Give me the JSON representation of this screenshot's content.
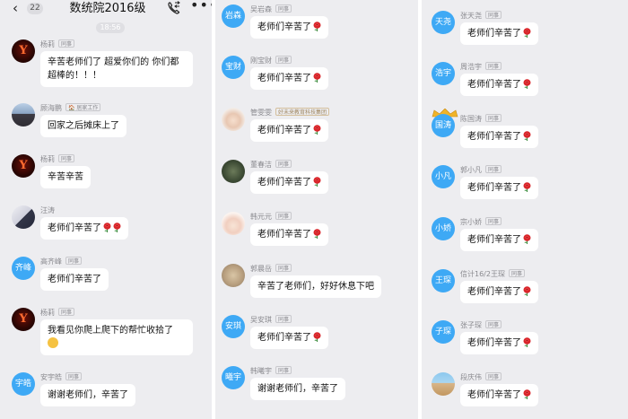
{
  "header": {
    "back_icon": "chevron-left-icon",
    "badge": "22",
    "title": "数统院2016级",
    "call_icon": "phone-call-icon",
    "more_icon": "more-icon",
    "time": "18:56"
  },
  "tags": {
    "classmate": "同事",
    "home": "居家工作",
    "vip": "好未来教育科技集团"
  },
  "col1": [
    {
      "avatar_text": "",
      "sender": "杨莉",
      "text": "辛苦老师们了 超爱你们的 你们都",
      "text2": "超棒的！！！"
    },
    {
      "avatar_text": "",
      "sender": "顾海鹏",
      "text": "回家之后摊床上了"
    },
    {
      "avatar_text": "",
      "sender": "杨莉",
      "text": "辛苦辛苦"
    },
    {
      "avatar_text": "",
      "sender": "汪涛",
      "text": "老师们辛苦了"
    },
    {
      "avatar_text": "齐峰",
      "sender": "高齐峰",
      "text": "老师们辛苦了"
    },
    {
      "avatar_text": "",
      "sender": "杨莉",
      "text": "我看见你爬上爬下的帮忙收拾了"
    },
    {
      "avatar_text": "宇皓",
      "sender": "安宇皓",
      "text": "谢谢老师们，辛苦了"
    }
  ],
  "col2": [
    {
      "avatar_text": "岩森",
      "sender": "吴岩森",
      "text": "老师们辛苦了"
    },
    {
      "avatar_text": "宝财",
      "sender": "刚宝财",
      "text": "老师们辛苦了"
    },
    {
      "avatar_text": "",
      "sender": "管雯雯",
      "text": "老师们辛苦了"
    },
    {
      "avatar_text": "",
      "sender": "董春洁",
      "text": "老师们辛苦了"
    },
    {
      "avatar_text": "",
      "sender": "韩元元",
      "text": "老师们辛苦了"
    },
    {
      "avatar_text": "",
      "sender": "郭晨岳",
      "text": "辛苦了老师们，好好休息下吧"
    },
    {
      "avatar_text": "安琪",
      "sender": "吴安琪",
      "text": "老师们辛苦了"
    },
    {
      "avatar_text": "曦宇",
      "sender": "韩曦宇",
      "text": "谢谢老师们，辛苦了"
    }
  ],
  "col3": [
    {
      "avatar_text": "天尧",
      "sender": "张天尧",
      "text": "老师们辛苦了"
    },
    {
      "avatar_text": "浩宇",
      "sender": "周浩宇",
      "text": "老师们辛苦了"
    },
    {
      "avatar_text": "国涛",
      "sender": "陈国涛",
      "text": "老师们辛苦了"
    },
    {
      "avatar_text": "小凡",
      "sender": "郭小凡",
      "text": "老师们辛苦了"
    },
    {
      "avatar_text": "小娇",
      "sender": "宗小娇",
      "text": "老师们辛苦了"
    },
    {
      "avatar_text": "王琛",
      "sender": "信计16/2王琛",
      "text": "老师们辛苦了"
    },
    {
      "avatar_text": "子琛",
      "sender": "张子琛",
      "text": "老师们辛苦了"
    },
    {
      "avatar_text": "",
      "sender": "段庆伟",
      "text": "老师们辛苦了"
    }
  ],
  "colors": {
    "avatar_blue": "#3ea9f5",
    "bubble": "#ffffff",
    "background": "#ededf0",
    "rose": "#d9262b"
  }
}
